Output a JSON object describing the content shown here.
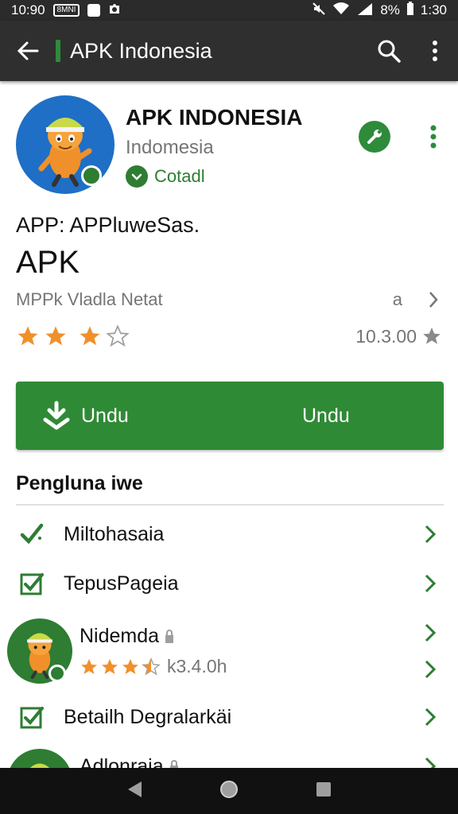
{
  "status_bar": {
    "time_left": "10:90",
    "box_text": "8MNI",
    "battery_text": "8%",
    "time_right": "1:30"
  },
  "toolbar": {
    "title": "APK Indonesia"
  },
  "app": {
    "name": "APK INDONESIA",
    "subtitle": "Indomesia",
    "verified_label": "Cotadl",
    "line1": "APP: APPluweSas.",
    "line2": "APK",
    "meta_text": "MPPk Vladla Netat",
    "meta_mid": "a",
    "rating": 3.5,
    "rating_count": "10.3.00"
  },
  "download": {
    "label_left": "Undu",
    "label_right": "Undu"
  },
  "section": {
    "title": "Pengluna iwe"
  },
  "list": {
    "item1": "Miltohasaia",
    "item2": "TepusPageia",
    "item3_title": "Nidemda",
    "item3_rating": 3.5,
    "item3_count": "k3.4.0h",
    "item4": "Betailh Degralarkäi",
    "item5": "Adlonraia"
  },
  "colors": {
    "accent": "#2f8a35",
    "star": "#f0902a",
    "toolbar": "#2f2f2f",
    "avatar_blue": "#1f6fc6"
  }
}
